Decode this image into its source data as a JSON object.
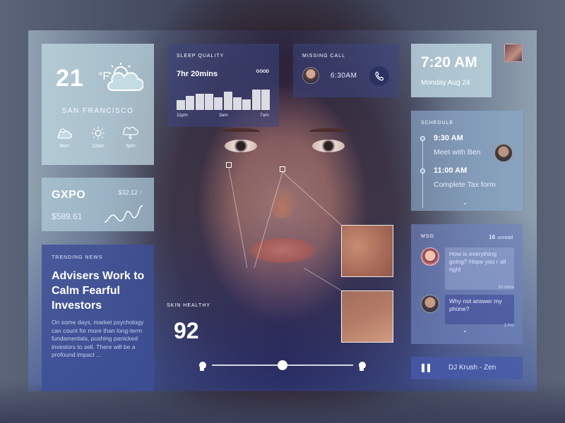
{
  "weather": {
    "temp": "21",
    "unit": "°F",
    "city": "SAN FRANCISCO",
    "forecast": [
      {
        "time": "8am",
        "icon": "partly-cloudy-icon"
      },
      {
        "time": "12am",
        "icon": "sun-icon"
      },
      {
        "time": "5pm",
        "icon": "thunder-cloud-icon"
      }
    ]
  },
  "stock": {
    "symbol": "GXPO",
    "change": "$32.12 ↑",
    "price": "$589.61"
  },
  "news": {
    "tag": "TRENDING NEWS",
    "headline": "Advisers Work to Calm Fearful Investors",
    "body": "On some days, market psychology can count for more than long-term fundamentals, pushing panicked investors to sell. There will be a profound impact ..."
  },
  "sleep": {
    "title": "SLEEP QUALITY",
    "duration": "7hr 20mins",
    "grade": "GOOD",
    "bars": [
      0.45,
      0.65,
      0.75,
      0.75,
      0.6,
      0.85,
      0.6,
      0.5,
      0.95,
      0.95
    ],
    "ticks": [
      "11pm",
      "3am",
      "7am"
    ]
  },
  "missed_call": {
    "title": "MISSING CALL",
    "time": "6:30AM"
  },
  "clock": {
    "time": "7:20 AM",
    "date": "Monday  Aug 24"
  },
  "schedule": {
    "title": "SCHEDULE",
    "events": [
      {
        "time": "9:30 AM",
        "title": "Meet with Ben"
      },
      {
        "time": "11:00 AM",
        "title": "Complete Tax form"
      }
    ],
    "more": "⌄"
  },
  "messages": {
    "title": "MSG",
    "unread_count": "16",
    "unread_label": "unread",
    "items": [
      {
        "text": "How is everything going? Hope you r all right",
        "stamp": "20 mins"
      },
      {
        "text": "Why not answer my phone?",
        "stamp": "1 hrs"
      }
    ],
    "more": "⌄"
  },
  "player": {
    "track": "DJ Krush - Zen"
  },
  "skin": {
    "label": "SKIN HEALTHY",
    "score": "92",
    "slider_value": 0.5
  },
  "colors": {
    "accent": "#3c4e96",
    "panel_light": "#c3dce4"
  }
}
